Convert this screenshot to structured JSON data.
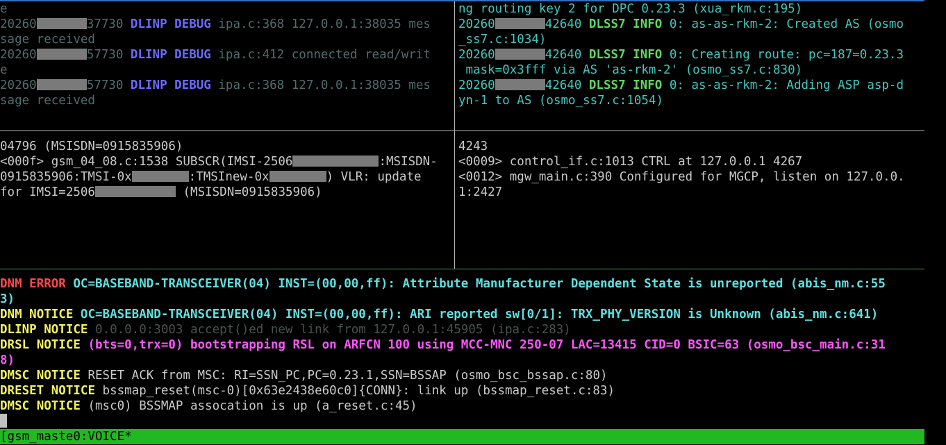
{
  "pane_top_left": {
    "lines": [
      {
        "a": "e"
      },
      {
        "pre": "20260",
        "post": "37730",
        "sub": "DLINP",
        "lvl": "DEBUG",
        "msg": "ipa.c:368 127.0.0.1:38035 mes"
      },
      {
        "a": "sage received"
      },
      {
        "pre": "20260",
        "post": "57730",
        "sub": "DLINP",
        "lvl": "DEBUG",
        "msg": "ipa.c:412 connected read/writ"
      },
      {
        "a": "e"
      },
      {
        "pre": "20260",
        "post": "57730",
        "sub": "DLINP",
        "lvl": "DEBUG",
        "msg": "ipa.c:368 127.0.0.1:38035 mes"
      },
      {
        "a": "sage received"
      }
    ]
  },
  "pane_top_right": {
    "lines": [
      {
        "a": "ng routing key 2 for DPC 0.23.3 (xua_rkm.c:195)"
      },
      {
        "pre": "20260",
        "post": "42640",
        "sub": "DLSS7",
        "lvl": "INFO",
        "msg": "0: as-as-rkm-2: Created AS (osmo"
      },
      {
        "a": "_ss7.c:1034)"
      },
      {
        "pre": "20260",
        "post": "42640",
        "sub": "DLSS7",
        "lvl": "INFO",
        "msg": "0: Creating route: pc=187=0.23.3"
      },
      {
        "a": " mask=0x3fff via AS 'as-rkm-2' (osmo_ss7.c:830)"
      },
      {
        "pre": "20260",
        "post": "42640",
        "sub": "DLSS7",
        "lvl": "INFO",
        "msg": "0: as-as-rkm-2: Adding ASP asp-d"
      },
      {
        "a": "yn-1 to AS (osmo_ss7.c:1054)"
      }
    ]
  },
  "pane_mid_left": {
    "l1": "04796 (MSISDN=0915835906)",
    "l2a": "<000f> gsm_04_08.c:1538 SUBSCR(IMSI-2506",
    "l2b": ":MSISDN-",
    "l3a": "0915835906:TMSI-0x",
    "l3b": ":TMSInew-0x",
    "l3c": ") VLR: update",
    "l4a": "for IMSI=2506",
    "l4b": " (MSISDN=0915835906)"
  },
  "pane_mid_right": {
    "lines": [
      "4243",
      "<0009> control_if.c:1013 CTRL at 127.0.0.1 4267",
      "<0012> mgw_main.c:390 Configured for MGCP, listen on 127.0.0.",
      "1:2427"
    ]
  },
  "pane_bottom": {
    "l1_sub": "DNM",
    "l1_lvl": "ERROR",
    "l1_msg": "OC=BASEBAND-TRANSCEIVER(04) INST=(00,00,ff): Attribute Manufacturer Dependent State is unreported (abis_nm.c:55",
    "l2_msg": "3)",
    "l3_sub": "DNM",
    "l3_lvl": "NOTICE",
    "l3_msg": "OC=BASEBAND-TRANSCEIVER(04) INST=(00,00,ff): ARI reported sw[0/1]: TRX_PHY_VERSION is Unknown (abis_nm.c:641)",
    "l4_sub": "DLINP",
    "l4_lvl": "NOTICE",
    "l4_msg": "0.0.0.0:3003 accept()ed new link from 127.0.0.1:45905 (ipa.c:283)",
    "l5_sub": "DRSL",
    "l5_lvl": "NOTICE",
    "l5_msg": "(bts=0,trx=0) bootstrapping RSL on ARFCN 100 using MCC-MNC 250-07 LAC=13415 CID=0 BSIC=63 (osmo_bsc_main.c:31",
    "l6_msg": "8)",
    "l7_sub": "DMSC",
    "l7_lvl": "NOTICE",
    "l7_msg": "RESET ACK from MSC: RI=SSN_PC,PC=0.23.1,SSN=BSSAP (osmo_bsc_bssap.c:80)",
    "l8_sub": "DRESET",
    "l8_lvl": "NOTICE",
    "l8_msg": "bssmap_reset(msc-0)[0x63e2438e60c0]{CONN}: link up (bssmap_reset.c:83)",
    "l9_sub": "DMSC",
    "l9_lvl": "NOTICE",
    "l9_msg": "(msc0) BSSMAP assocation is up (a_reset.c:45)"
  },
  "status_bar": {
    "text": "[gsm_maste0:VOICE*"
  }
}
